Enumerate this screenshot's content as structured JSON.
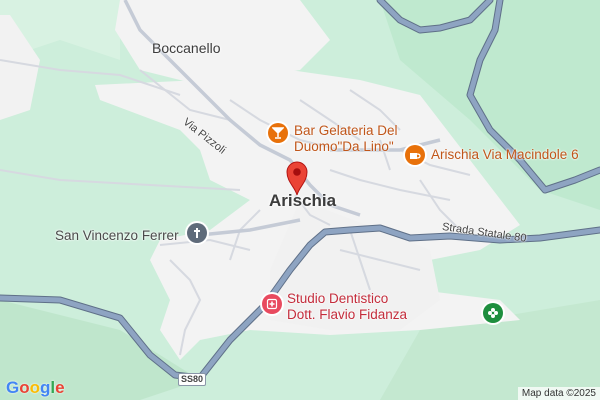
{
  "map": {
    "places": {
      "town": "Arischia",
      "village": "Boccanello"
    },
    "roads": {
      "via_pizzoli": "Via Pizzoli",
      "strada_statale": "Strada Statale 80",
      "shield": "SS80"
    },
    "pois": {
      "bar": {
        "line1": "Bar Gelateria Del",
        "line2": "Duomo\"Da Lino\"",
        "icon": "cocktail-icon",
        "color": "#e8710a"
      },
      "cafe": {
        "label": "Arischia Via Macindole 6",
        "icon": "coffee-cup-icon",
        "color": "#e8710a"
      },
      "church": {
        "label": "San Vincenzo Ferrer",
        "icon": "cross-icon",
        "color": "#5f6b7a"
      },
      "dentist": {
        "line1": "Studio Dentistico",
        "line2": "Dott. Flavio Fidanza",
        "icon": "medical-cross-icon",
        "color": "#e84a5f"
      },
      "nature": {
        "icon": "flower-icon",
        "color": "#1e8e3e"
      }
    },
    "marker": {
      "icon": "map-pin-icon",
      "color": "#ea4335"
    },
    "logo": "Google",
    "attribution": "Map data ©2025"
  }
}
